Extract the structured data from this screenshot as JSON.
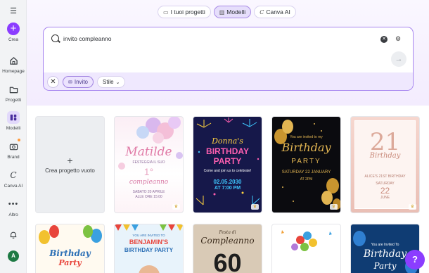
{
  "sidebar": {
    "menu_icon": "hamburger-icon",
    "items": [
      {
        "label": "Crea",
        "icon": "plus-icon"
      },
      {
        "label": "Homepage",
        "icon": "home-icon"
      },
      {
        "label": "Progetti",
        "icon": "folder-icon"
      },
      {
        "label": "Modelli",
        "icon": "templates-icon"
      },
      {
        "label": "Brand",
        "icon": "brand-icon"
      },
      {
        "label": "Canva AI",
        "icon": "canva-ai-icon"
      },
      {
        "label": "Altro",
        "icon": "more-icon"
      }
    ],
    "bell_icon": "bell-icon",
    "avatar_initial": "A"
  },
  "tabs": [
    {
      "label": "I tuoi progetti",
      "icon": "folder-icon"
    },
    {
      "label": "Modelli",
      "icon": "templates-icon",
      "active": true
    },
    {
      "label": "Canva AI",
      "icon": "canva-ai-icon"
    }
  ],
  "search": {
    "value": "invito compleanno",
    "chips": {
      "invite": "Invito",
      "style": "Stile"
    }
  },
  "blank_card": {
    "label": "Crea progetto vuoto"
  },
  "templates": [
    {
      "line1": "Matilde",
      "line2": "FESTEGGIA IL SUO",
      "line3": "1°",
      "line4": "compleanno",
      "line5": "SABATO 20 APRILE",
      "line6": "ALLE ORE 15:00"
    },
    {
      "line1": "Donna's",
      "line2": "BIRTHDAY",
      "line3": "PARTY",
      "line4": "Come and join us to celebrate!",
      "line5": "02.05.2030",
      "line6": "AT 7:00 PM"
    },
    {
      "line1": "You are invited to my",
      "line2": "Birthday",
      "line3": "PARTY",
      "line4": "SATURDAY 22 JANUARY",
      "line5": "AT 2PM",
      "line6": ""
    },
    {
      "line1": "21",
      "line2": "Birthday",
      "line3": "ALICE'S 21ST BIRTHDAY",
      "line4": "SATURDAY",
      "line5": "22",
      "line6": "JUNE"
    }
  ],
  "templates_row2": [
    {
      "line1": "Birthday",
      "line2": "Party"
    },
    {
      "line1": "YOU ARE INVITED TO",
      "line2": "BENJAMIN'S",
      "line3": "BIRTHDAY PARTY"
    },
    {
      "line1": "Festa di",
      "line2": "Compleanno",
      "line3": "60"
    },
    {
      "line1": ""
    },
    {
      "line1": "You are Invited To",
      "line2": "Birthday",
      "line3": "Party"
    }
  ],
  "help": {
    "label": "?"
  },
  "colors": {
    "accent": "#8b3dff",
    "accent_light": "#e6defb"
  }
}
